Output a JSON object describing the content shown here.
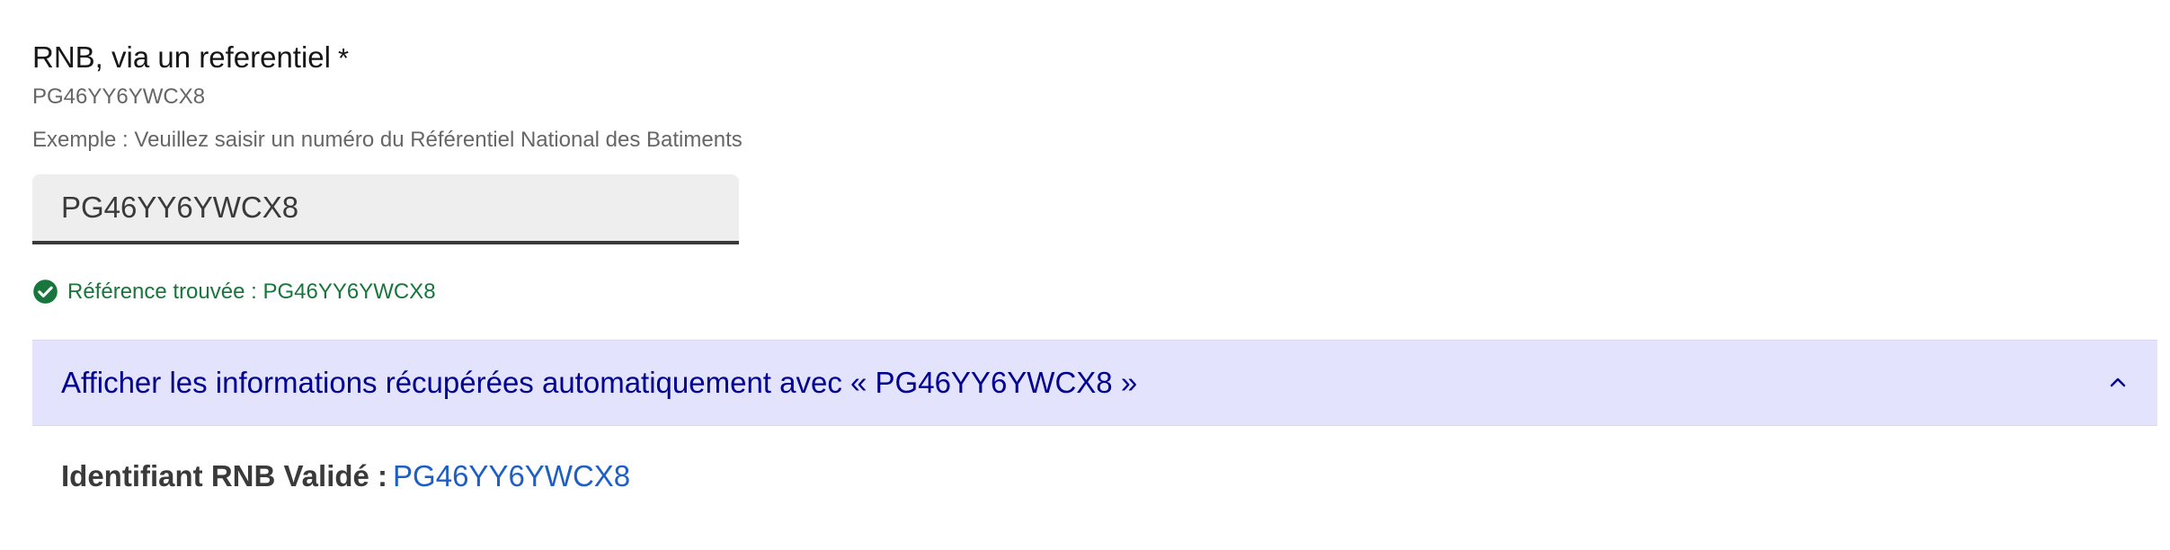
{
  "field": {
    "label": "RNB, via un referentiel",
    "required_mark": "*",
    "code_hint": "PG46YY6YWCX8",
    "example_hint": "Exemple : Veuillez saisir un numéro du Référentiel National des Batiments",
    "input_value": "PG46YY6YWCX8"
  },
  "status": {
    "message": "Référence trouvée : PG46YY6YWCX8",
    "color": "#18753c",
    "icon": "check-circle-icon"
  },
  "accordion": {
    "title": "Afficher les informations récupérées automatiquement avec « PG46YY6YWCX8 »",
    "expanded": true,
    "icon": "chevron-up-icon",
    "background": "#e3e3fd",
    "text_color": "#000091"
  },
  "details": {
    "key_label": "Identifiant RNB Validé :",
    "value": "PG46YY6YWCX8",
    "link_color": "#1f5fc5"
  }
}
